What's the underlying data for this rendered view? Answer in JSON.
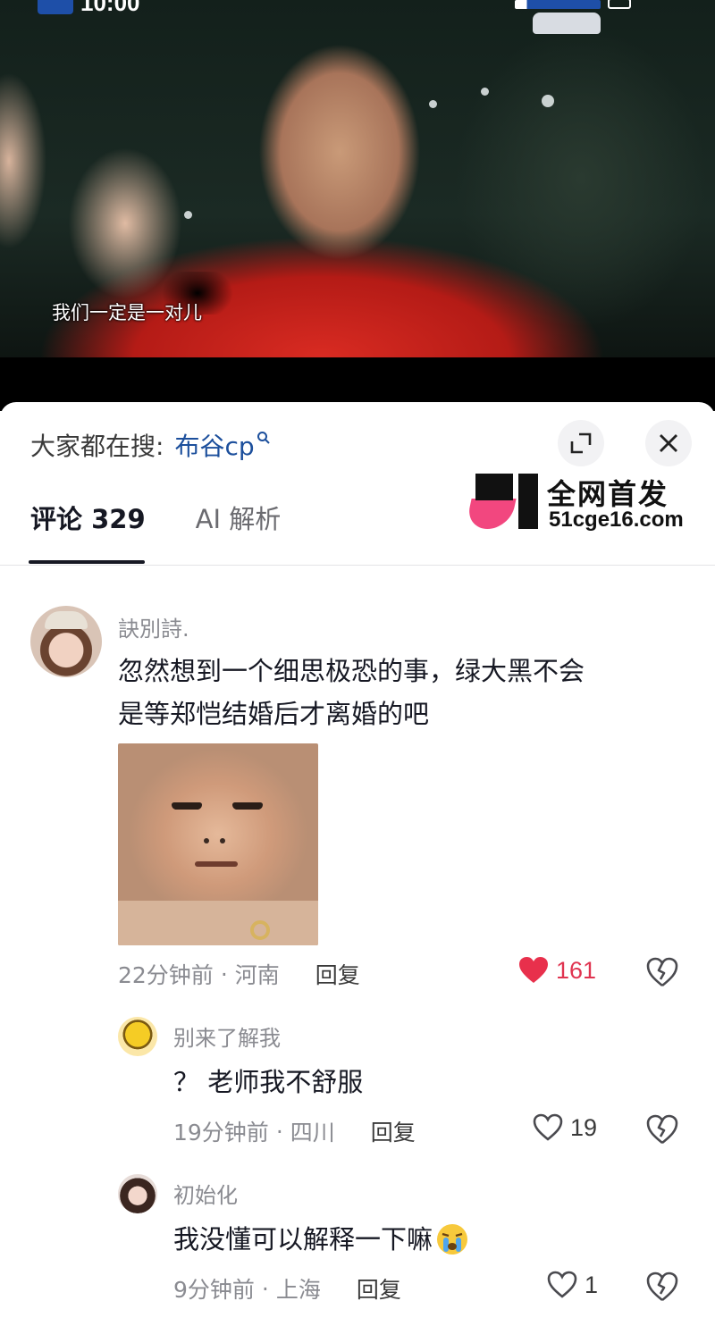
{
  "video": {
    "subtitle": "我们一定是一对儿",
    "status_time": "10:00"
  },
  "panel": {
    "search_label": "大家都在搜:",
    "search_term": "布谷cp",
    "search_icon": "search-icon"
  },
  "tabs": [
    {
      "label": "评论 329"
    },
    {
      "label": "AI 解析"
    }
  ],
  "watermark": {
    "title": "全网首发",
    "url": "51cge16.com"
  },
  "comments": [
    {
      "username": "訣別詩.",
      "text_line1": "忽然想到一个细思极恐的事，绿大黑不会",
      "text_line2": "是等郑恺结婚后才离婚的吧",
      "time": "22分钟前",
      "location": "河南",
      "reply": "回复",
      "likes": "161",
      "liked": true,
      "like_color": "#e8304c"
    },
    {
      "username": "别来了解我",
      "text": "？ 老师我不舒服",
      "time": "19分钟前",
      "location": "四川",
      "reply": "回复",
      "likes": "19"
    },
    {
      "username": "初始化",
      "text": "我没懂可以解释一下嘛",
      "emoji": "😭",
      "time": "9分钟前",
      "location": "上海",
      "reply": "回复",
      "likes": "1"
    }
  ]
}
